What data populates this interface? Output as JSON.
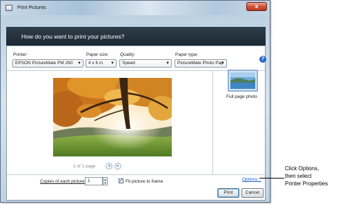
{
  "window": {
    "title": "Print Pictures",
    "close_glyph": "x"
  },
  "header": {
    "question": "How do you want to print your pictures?"
  },
  "options": {
    "printer": {
      "label": "Printer:",
      "value": "EPSON PictureMate PM 260"
    },
    "paper_size": {
      "label": "Paper size:",
      "value": "4 x 6 in"
    },
    "quality": {
      "label": "Quality:",
      "value": "Speed"
    },
    "paper_type": {
      "label": "Paper type:",
      "value": "PictureMate Photo Pap"
    },
    "help_glyph": "?"
  },
  "preview": {
    "image_icon": "autumn-tree-photo",
    "pager_text": "1 of 1 page",
    "prev_glyph": "◂",
    "next_glyph": "▸"
  },
  "layout": {
    "label": "Full page photo",
    "thumb_icon": "lake-landscape-thumbnail"
  },
  "bottom": {
    "copies_label": "Copies of each picture:",
    "copies_value": "1",
    "fit_label": "Fit picture to frame",
    "fit_checked": true,
    "options_link": "Options...",
    "print_button": "Print",
    "cancel_button": "Cancel"
  },
  "callout": {
    "line1": "Click Options,",
    "line2": "then select",
    "line3": "Printer Properties"
  },
  "colors": {
    "header": "#1c2833",
    "link": "#1e5bbf",
    "window_frame": "#b9cfe2"
  }
}
